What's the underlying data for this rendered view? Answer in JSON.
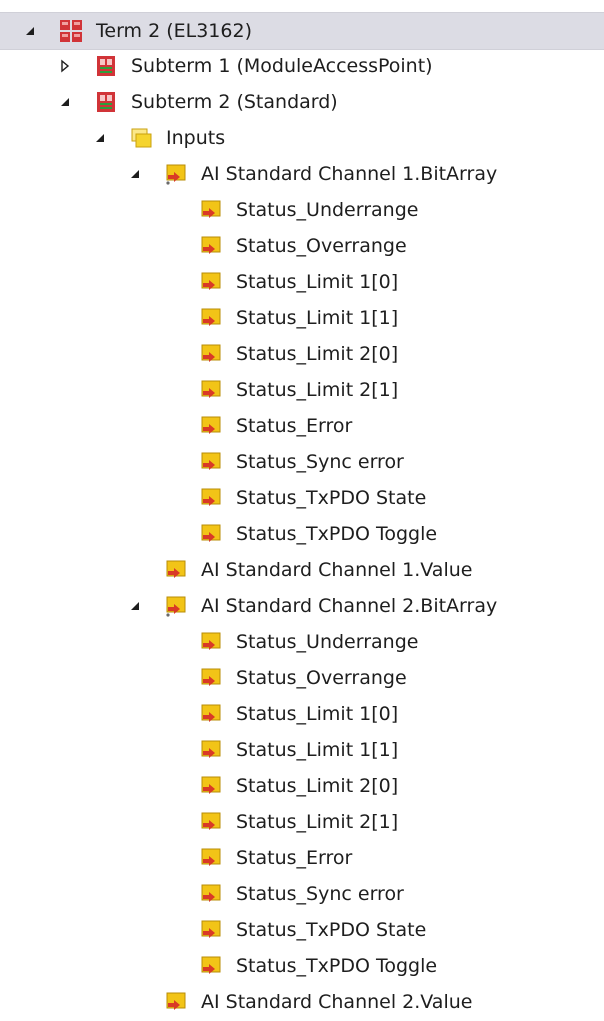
{
  "tree": {
    "term": {
      "label": "Term 2 (EL3162)",
      "icon": "terminal-icon",
      "expanded": true
    },
    "subterm1": {
      "label": "Subterm 1 (ModuleAccessPoint)",
      "icon": "module-icon",
      "expanded": false
    },
    "subterm2": {
      "label": "Subterm 2 (Standard)",
      "icon": "module-icon",
      "expanded": true
    },
    "inputs": {
      "label": "Inputs",
      "icon": "folder-inputs-icon",
      "expanded": true
    },
    "channel1_bitarray": {
      "label": "AI Standard Channel 1.BitArray",
      "icon": "input-variable-array-icon",
      "expanded": true,
      "children": [
        "Status_Underrange",
        "Status_Overrange",
        "Status_Limit 1[0]",
        "Status_Limit 1[1]",
        "Status_Limit 2[0]",
        "Status_Limit 2[1]",
        "Status_Error",
        "Status_Sync error",
        "Status_TxPDO State",
        "Status_TxPDO Toggle"
      ]
    },
    "channel1_value": {
      "label": "AI Standard Channel 1.Value",
      "icon": "input-variable-icon"
    },
    "channel2_bitarray": {
      "label": "AI Standard Channel 2.BitArray",
      "icon": "input-variable-array-icon",
      "expanded": true,
      "children": [
        "Status_Underrange",
        "Status_Overrange",
        "Status_Limit 1[0]",
        "Status_Limit 1[1]",
        "Status_Limit 2[0]",
        "Status_Limit 2[1]",
        "Status_Error",
        "Status_Sync error",
        "Status_TxPDO State",
        "Status_TxPDO Toggle"
      ]
    },
    "channel2_value": {
      "label": "AI Standard Channel 2.Value",
      "icon": "input-variable-icon"
    }
  },
  "colors": {
    "selection_background": "#dcdce4",
    "terminal_red": "#d13438",
    "module_red": "#d13438",
    "folder_yellow": "#f5d42e",
    "variable_yellow": "#f2c417",
    "variable_red": "#d93a26",
    "text": "#1e1e1e"
  }
}
